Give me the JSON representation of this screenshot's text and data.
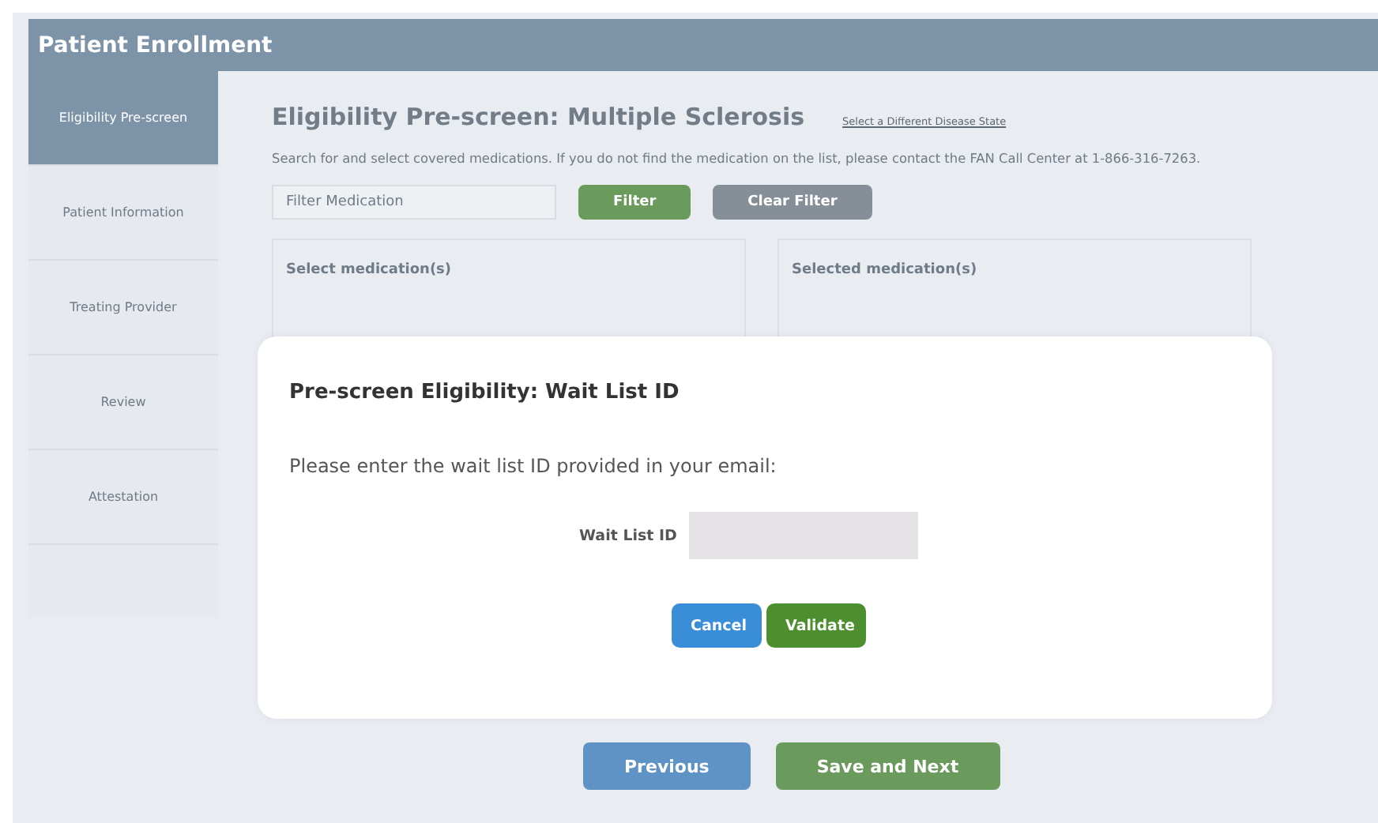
{
  "header": {
    "title": "Patient Enrollment"
  },
  "sidebar": {
    "items": [
      {
        "label": "Eligibility Pre-screen",
        "selected": true
      },
      {
        "label": "Patient Information",
        "selected": false
      },
      {
        "label": "Treating Provider",
        "selected": false
      },
      {
        "label": "Review",
        "selected": false
      },
      {
        "label": "Attestation",
        "selected": false
      }
    ]
  },
  "content": {
    "title": "Eligibility Pre-screen: Multiple Sclerosis",
    "link": "Select a Different Disease State",
    "instruction": "Search for and select covered medications. If you do not find the medication on the list, please contact the FAN Call Center at 1-866-316-7263.",
    "filter": {
      "placeholder": "Filter Medication"
    },
    "filter_buttons": [
      {
        "label": "Filter",
        "kind": "primary"
      },
      {
        "label": "Clear Filter",
        "kind": "secondary"
      }
    ],
    "panels": [
      {
        "heading": "Select medication(s)"
      },
      {
        "heading": "Selected medication(s)"
      }
    ],
    "nav_buttons": [
      {
        "label": "Previous",
        "kind": "back"
      },
      {
        "label": "Save and Next",
        "kind": "next"
      }
    ]
  },
  "dialog": {
    "title": "Pre-screen Eligibility: Wait List ID",
    "message": "Please enter the wait list ID provided in your email:",
    "field_label": "Wait List ID",
    "buttons": [
      {
        "label": "Cancel",
        "kind": "cancel"
      },
      {
        "label": "Validate",
        "kind": "confirm"
      }
    ]
  }
}
